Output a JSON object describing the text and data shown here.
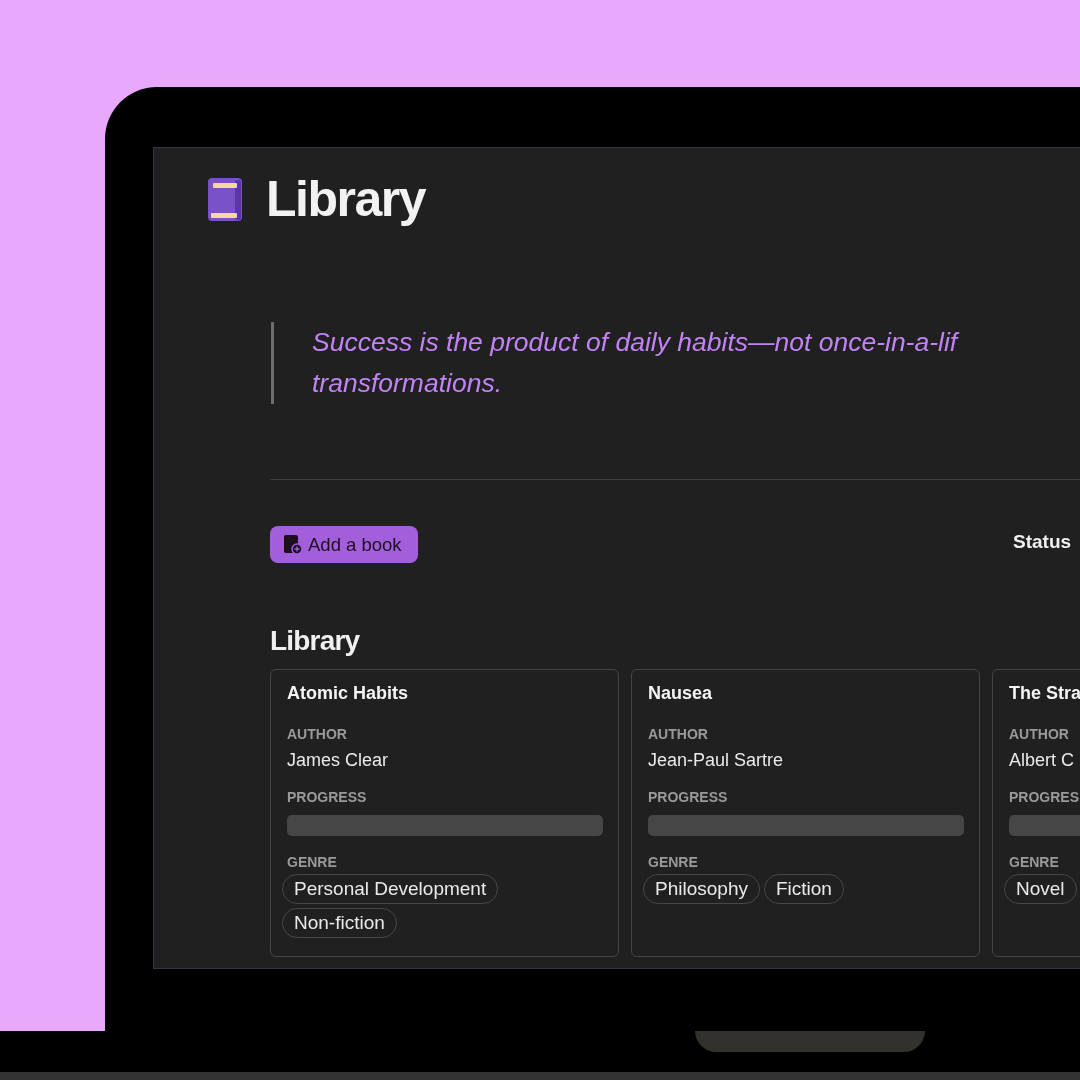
{
  "page": {
    "title": "Library"
  },
  "quote": {
    "text": "Success is the product of daily habits—not once-in-a-lif",
    "continuation": "transformations."
  },
  "toolbar": {
    "add_button": "Add a book",
    "status_label": "Status"
  },
  "section": {
    "title": "Library"
  },
  "books": [
    {
      "title": "Atomic Habits",
      "fields": [
        {
          "kind": "text",
          "label": "AUTHOR",
          "value": "James Clear"
        },
        {
          "kind": "progress",
          "label": "PROGRESS",
          "level": 0
        },
        {
          "kind": "tags",
          "label": "GENRE",
          "tags": [
            "Personal Development",
            "Non-fiction"
          ]
        }
      ]
    },
    {
      "title": "Nausea",
      "fields": [
        {
          "kind": "text",
          "label": "AUTHOR",
          "value": "Jean-Paul Sartre"
        },
        {
          "kind": "progress",
          "label": "PROGRESS",
          "level": 0
        },
        {
          "kind": "tags",
          "label": "GENRE",
          "tags": [
            "Philosophy",
            "Fiction"
          ]
        }
      ]
    },
    {
      "title": "The Stra",
      "fields": [
        {
          "kind": "text",
          "label": "AUTHOR",
          "value": "Albert C"
        },
        {
          "kind": "progress",
          "label": "PROGRES",
          "level": 0
        },
        {
          "kind": "tags",
          "label": "GENRE",
          "tags": [
            "Novel"
          ]
        }
      ]
    }
  ]
}
